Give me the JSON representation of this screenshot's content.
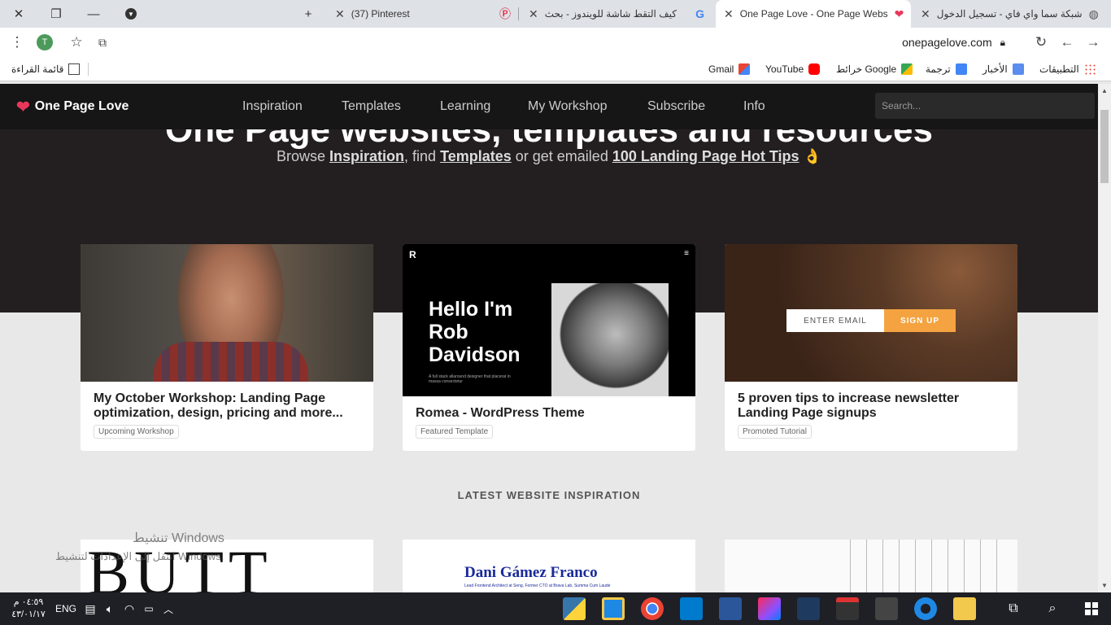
{
  "tabs": [
    {
      "title": "شبكة سما واي فاي - تسجيل الدخول"
    },
    {
      "title": "One Page Love - One Page Webs"
    },
    {
      "title": "كيف التقط شاشة للويندوز - بحث"
    },
    {
      "title": "(37) Pinterest"
    }
  ],
  "toolbar": {
    "avatar": "T",
    "url": "onepagelove.com"
  },
  "bookmarks": {
    "apps": "التطبيقات",
    "news": "الأخبار",
    "translate": "ترجمة",
    "maps": "خرائط Google",
    "youtube": "YouTube",
    "gmail": "Gmail",
    "reading_list": "قائمة القراءة"
  },
  "site": {
    "logo": "One Page Love",
    "nav": [
      "Inspiration",
      "Templates",
      "Learning",
      "My Workshop",
      "Subscribe",
      "Info"
    ],
    "search_placeholder": "Search...",
    "hero_title": "One Page websites, templates and resources",
    "hero_sub_1": "Browse ",
    "hero_link_1": "Inspiration",
    "hero_sub_2": ", find ",
    "hero_link_2": "Templates",
    "hero_sub_3": " or get emailed ",
    "hero_link_3": "100 Landing Page Hot Tips",
    "hero_emoji": "👌"
  },
  "cards": [
    {
      "title": "My October Workshop: Landing Page optimization, design, pricing and more...",
      "tag": "Upcoming Workshop"
    },
    {
      "title": "Romea - WordPress Theme",
      "tag": "Featured Template",
      "thumb_text": "Hello I'm Rob Davidson",
      "thumb_small": "A full stack allaround designer that placerat in massa consectetur"
    },
    {
      "title": "5 proven tips to increase newsletter Landing Page signups",
      "tag": "Promoted Tutorial",
      "thumb_input": "ENTER EMAIL",
      "thumb_btn": "SIGN UP"
    }
  ],
  "section_heading": "LATEST WEBSITE INSPIRATION",
  "bottom_cards": [
    "BUTT",
    "Dani Gámez Franco",
    ""
  ],
  "bottom_card_2_sub": "Lead Frontend Architect at Seng, Former CTO at Brava Lab, Summa Cum Laude",
  "watermark": {
    "line1": "تنشيط Windows",
    "line2": "انتقل إلى الإعدادات لتنشيط Windows."
  },
  "taskbar": {
    "time": "٠٤:٥٩ م",
    "date": "٤٣/٠١/١٧",
    "lang": "ENG"
  }
}
